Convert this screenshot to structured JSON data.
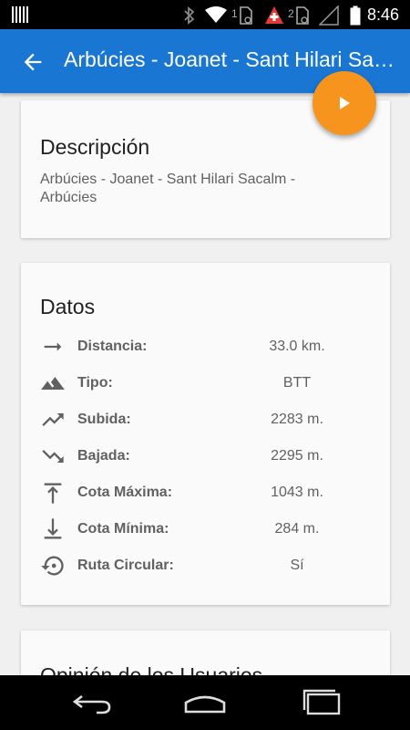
{
  "status_bar": {
    "time": "8:46",
    "icons": [
      "barcode-icon",
      "bluetooth-icon",
      "wifi-icon",
      "sim-1-icon",
      "swiss-flag-icon",
      "sim-2-icon",
      "signal-icon",
      "battery-icon"
    ],
    "sim1_label": "1",
    "sim2_label": "2"
  },
  "app_bar": {
    "title": "Arbúcies - Joanet - Sant Hilari Sacalm - Arbúcies",
    "back_icon": "arrow-back-icon",
    "color": "#1976d2"
  },
  "fab": {
    "icon": "play-icon",
    "color": "#f7941d"
  },
  "descripcion": {
    "heading": "Descripción",
    "text": "Arbúcies - Joanet - Sant Hilari Sacalm - Arbúcies"
  },
  "datos": {
    "heading": "Datos",
    "rows": [
      {
        "icon": "arrow-right-icon",
        "label": "Distancia:",
        "value": "33.0 km."
      },
      {
        "icon": "terrain-icon",
        "label": "Tipo:",
        "value": "BTT"
      },
      {
        "icon": "trending-up-icon",
        "label": "Subida:",
        "value": "2283 m."
      },
      {
        "icon": "trending-down-icon",
        "label": "Bajada:",
        "value": "2295 m."
      },
      {
        "icon": "max-elevation-icon",
        "label": "Cota Máxima:",
        "value": "1043 m."
      },
      {
        "icon": "min-elevation-icon",
        "label": "Cota Mínima:",
        "value": "284 m."
      },
      {
        "icon": "circular-route-icon",
        "label": "Ruta Circular:",
        "value": "Sí"
      }
    ]
  },
  "opinion": {
    "heading": "Opinión de los Usuarios"
  },
  "nav_bar": {
    "icons": [
      "back-nav-icon",
      "home-nav-icon",
      "recents-nav-icon"
    ]
  }
}
